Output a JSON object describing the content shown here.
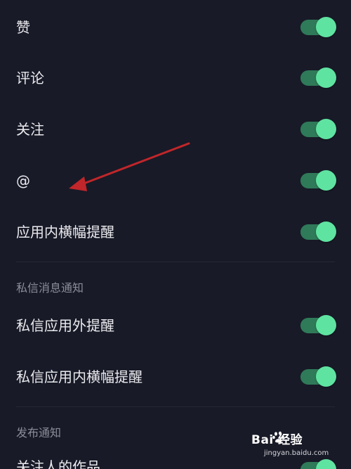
{
  "settings": {
    "items": [
      {
        "label": "赞",
        "enabled": true
      },
      {
        "label": "评论",
        "enabled": true
      },
      {
        "label": "关注",
        "enabled": true
      },
      {
        "label": "@",
        "enabled": true
      },
      {
        "label": "应用内横幅提醒",
        "enabled": true
      }
    ]
  },
  "private_message": {
    "header": "私信消息通知",
    "items": [
      {
        "label": "私信应用外提醒",
        "enabled": true
      },
      {
        "label": "私信应用内横幅提醒",
        "enabled": true
      }
    ]
  },
  "publish": {
    "header": "发布通知",
    "items": [
      {
        "label": "关注人的作品",
        "enabled": true
      }
    ]
  },
  "watermark": {
    "brand": "Bai 经验",
    "url": "jingyan.baidu.com"
  },
  "colors": {
    "background": "#181a27",
    "toggle_track": "#2f7a59",
    "toggle_knob": "#5fe3a1",
    "annotation_arrow": "#c0262a",
    "section_header": "#8b8d99"
  },
  "icons": {
    "annotation": "red-arrow",
    "watermark": "baidu-paw-icon"
  }
}
